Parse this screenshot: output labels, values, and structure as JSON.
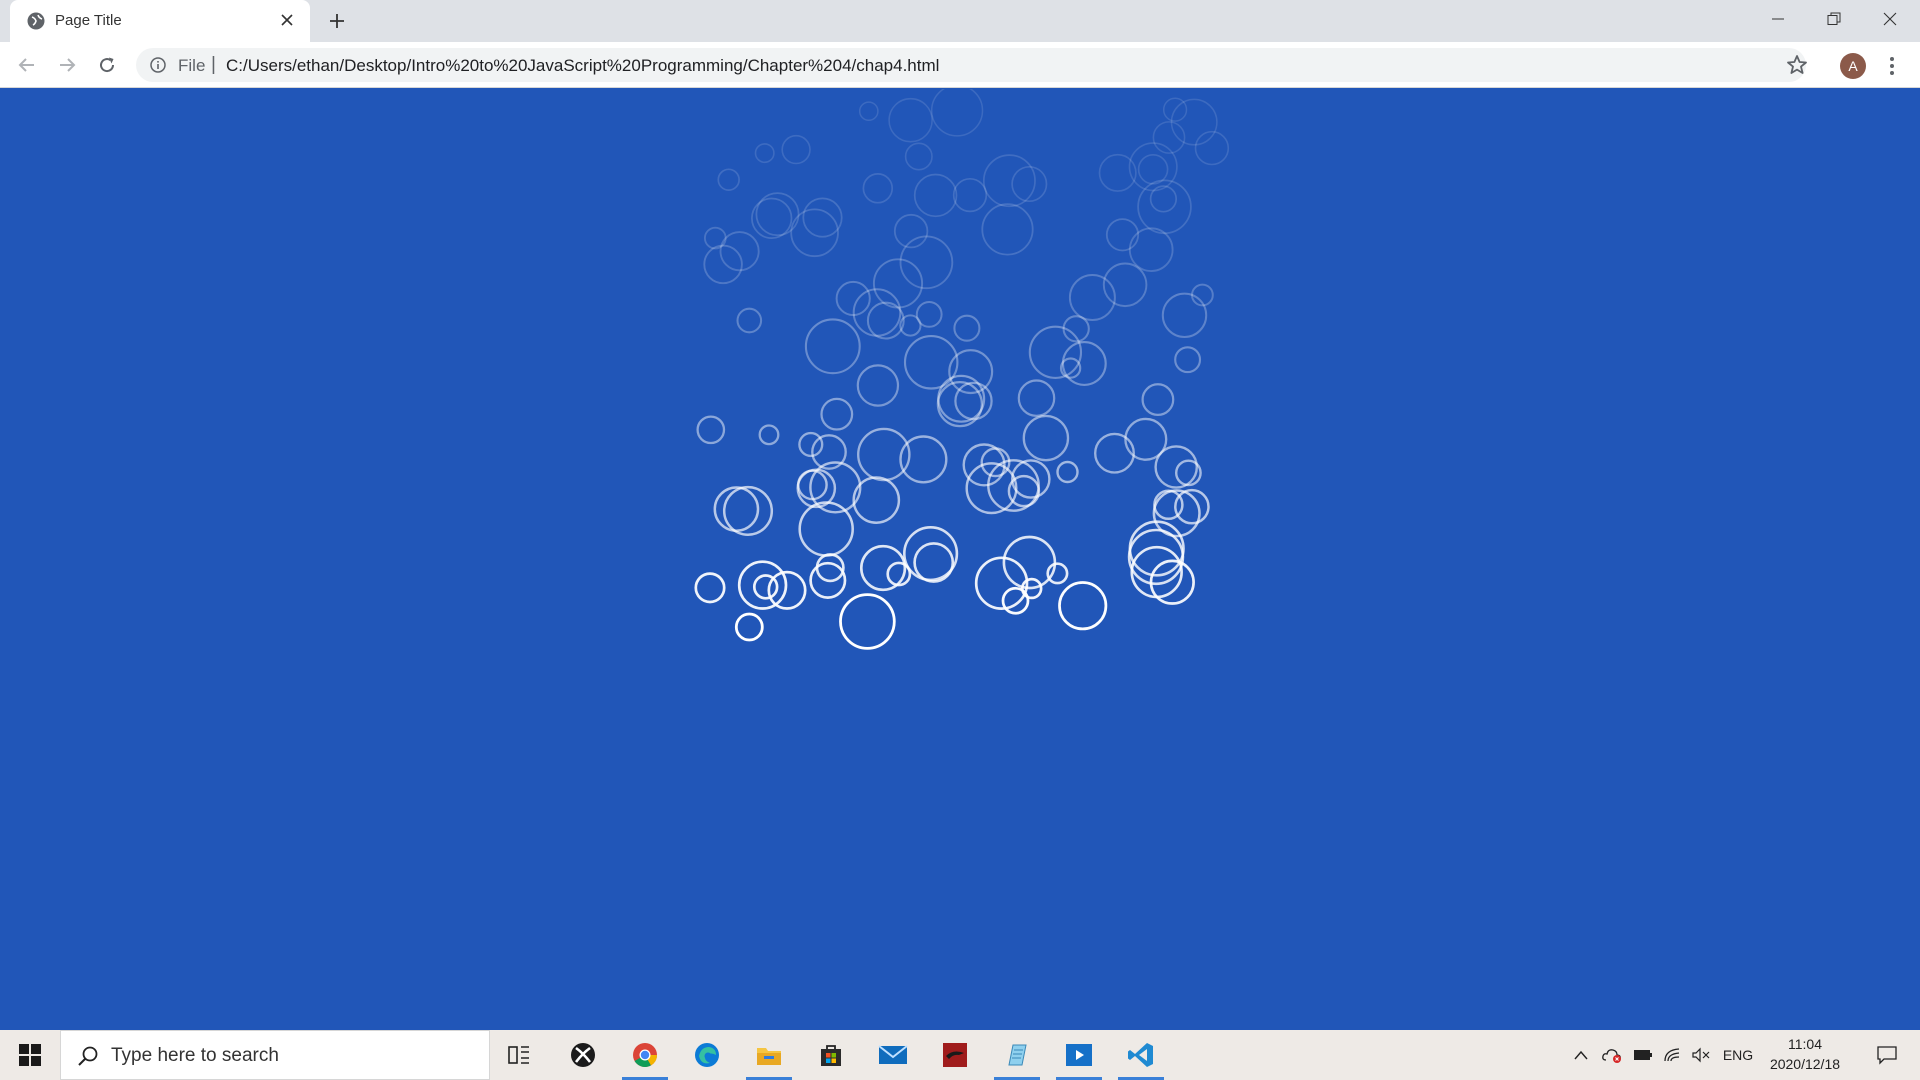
{
  "browser": {
    "tab": {
      "title": "Page Title"
    },
    "address": {
      "scheme_label": "File",
      "url": "C:/Users/ethan/Desktop/Intro%20to%20JavaScript%20Programming/Chapter%204/chap4.html"
    },
    "profile_initial": "A"
  },
  "page": {
    "background_color": "#2156b8",
    "bubble_color": "#ffffff",
    "bubble_count": 110
  },
  "taskbar": {
    "search_placeholder": "Type here to search",
    "apps": [
      "task-view",
      "xbox",
      "chrome",
      "edge",
      "file-explorer",
      "microsoft-store",
      "mail",
      "game-app",
      "notepad-app",
      "media-player",
      "vscode"
    ],
    "tray": {
      "language": "ENG",
      "time": "11:04",
      "date": "2020/12/18"
    }
  },
  "colors": {
    "accent_active": "#3a80d8",
    "chrome_frame": "#dee1e6"
  }
}
